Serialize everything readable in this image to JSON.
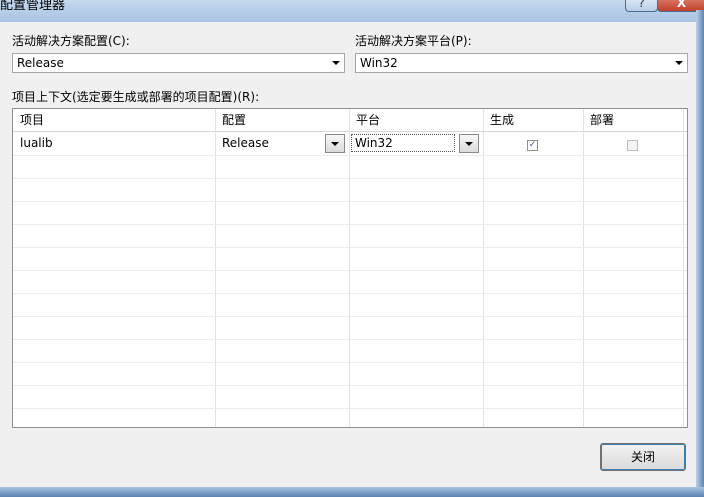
{
  "window": {
    "title": "配置管理器",
    "help_label": "?",
    "close_label": "X"
  },
  "active_config": {
    "label": "活动解决方案配置(C):",
    "value": "Release"
  },
  "active_platform": {
    "label": "活动解决方案平台(P):",
    "value": "Win32"
  },
  "project_context": {
    "label": "项目上下文(选定要生成或部署的项目配置)(R):"
  },
  "table": {
    "headers": [
      "项目",
      "配置",
      "平台",
      "生成",
      "部署"
    ],
    "rows": [
      {
        "project": "lualib",
        "config": "Release",
        "platform": "Win32",
        "build": true,
        "deploy": false
      }
    ]
  },
  "buttons": {
    "close": "关闭"
  },
  "icons": {
    "dropdown": "chevron-down-icon",
    "check": "checkmark-icon"
  }
}
